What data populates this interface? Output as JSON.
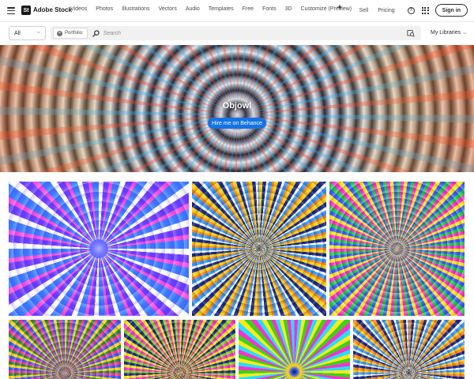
{
  "brand": {
    "badge": "St",
    "name": "Adobe Stock"
  },
  "nav": {
    "links": [
      "Videos",
      "Photos",
      "Illustrations",
      "Vectors",
      "Audio",
      "Templates",
      "Free",
      "Fonts",
      "3D",
      "Customize (Preview)"
    ],
    "right": {
      "sell": "Sell",
      "pricing": "Pricing",
      "help": "?",
      "signin": "Sign in"
    }
  },
  "search": {
    "filter_value": "All",
    "chip_label": "Portfolio:",
    "placeholder": "Search",
    "libraries_label": "My Libraries"
  },
  "hero": {
    "title": "Objowl",
    "button_label": "Hire me on Behance"
  },
  "colors": {
    "accent_blue": "#1473e6",
    "text_dark": "#2c2c2c"
  },
  "gallery": {
    "items": [
      {
        "name": "thumb-purple-starburst"
      },
      {
        "name": "thumb-yellow-blue-radial"
      },
      {
        "name": "thumb-green-rainbow-radial"
      },
      {
        "name": "thumb-bottom-1"
      },
      {
        "name": "thumb-bottom-2"
      },
      {
        "name": "thumb-bottom-3"
      },
      {
        "name": "thumb-bottom-4"
      }
    ]
  }
}
